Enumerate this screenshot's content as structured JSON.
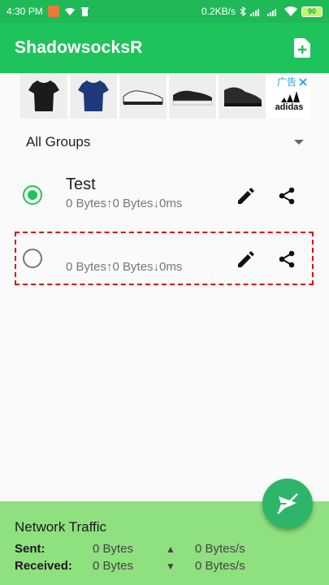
{
  "status_bar": {
    "time": "4:30 PM",
    "network_speed": "0.2KB/s",
    "battery": "90"
  },
  "app_bar": {
    "title": "ShadowsocksR",
    "add_icon": "file-add-icon"
  },
  "ad": {
    "label": "广告",
    "brand": "adidas"
  },
  "groups": {
    "selected": "All Groups"
  },
  "profiles": [
    {
      "name": "Test",
      "stats": "0 Bytes↑0 Bytes↓0ms",
      "selected": true
    },
    {
      "name": "",
      "stats": "0 Bytes↑0 Bytes↓0ms",
      "selected": false
    }
  ],
  "traffic": {
    "heading": "Network Traffic",
    "sent_label": "Sent:",
    "sent_total": "0 Bytes",
    "sent_arrow": "▲",
    "sent_rate": "0 Bytes/s",
    "received_label": "Received:",
    "received_total": "0 Bytes",
    "received_arrow": "▼",
    "received_rate": "0 Bytes/s"
  },
  "colors": {
    "primary": "#1fc35c",
    "traffic_bg": "#8fe07f",
    "selection_box": "#d11111"
  }
}
